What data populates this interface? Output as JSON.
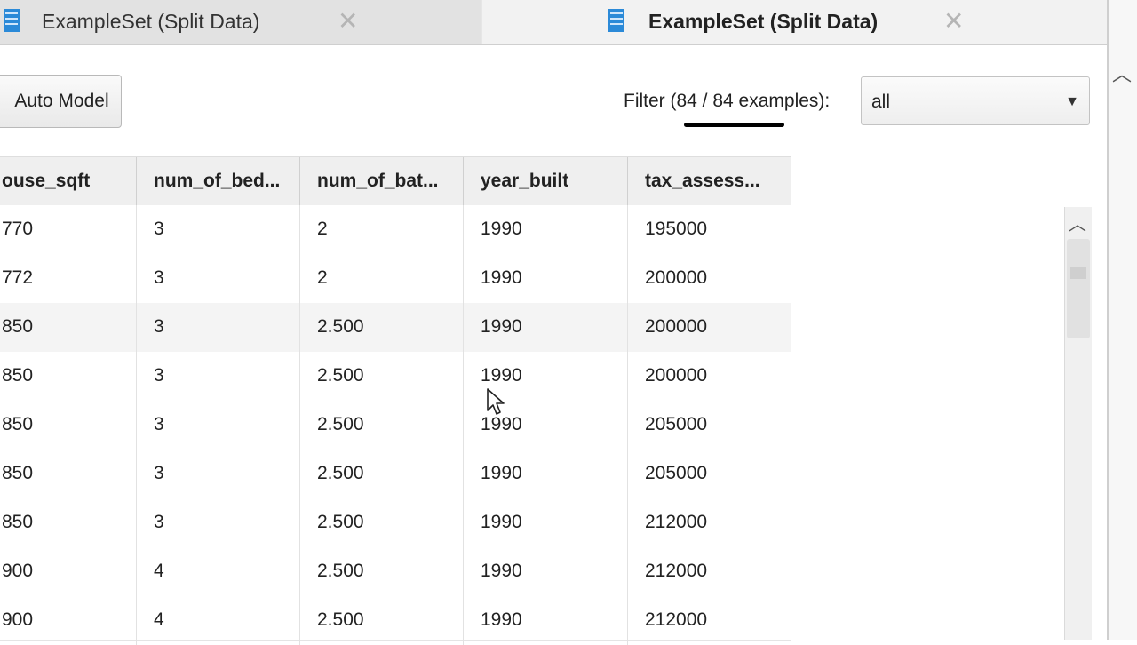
{
  "tabs": [
    {
      "title": "ExampleSet (Split Data)",
      "active": false
    },
    {
      "title": "ExampleSet (Split Data)",
      "active": true
    }
  ],
  "icons": {
    "tab": "data-table-icon",
    "close": "close-icon",
    "dropdown": "chevron-down-icon",
    "scroll_up": "chevron-up-icon",
    "cursor": "mouse-pointer-icon"
  },
  "colors": {
    "tab_icon": "#2b8ad8",
    "underline": "#000000"
  },
  "toolbar": {
    "auto_model_label": "Auto Model",
    "filter_label": "Filter (84 / 84 examples):",
    "filter_value": "all"
  },
  "table": {
    "columns": [
      "ouse_sqft",
      "num_of_bed...",
      "num_of_bat...",
      "year_built",
      "tax_assess..."
    ],
    "rows": [
      [
        "770",
        "3",
        "2",
        "1990",
        "195000"
      ],
      [
        "772",
        "3",
        "2",
        "1990",
        "200000"
      ],
      [
        "850",
        "3",
        "2.500",
        "1990",
        "200000"
      ],
      [
        "850",
        "3",
        "2.500",
        "1990",
        "200000"
      ],
      [
        "850",
        "3",
        "2.500",
        "1990",
        "205000"
      ],
      [
        "850",
        "3",
        "2.500",
        "1990",
        "205000"
      ],
      [
        "850",
        "3",
        "2.500",
        "1990",
        "212000"
      ],
      [
        "900",
        "4",
        "2.500",
        "1990",
        "212000"
      ],
      [
        "900",
        "4",
        "2.500",
        "1990",
        "212000"
      ]
    ]
  }
}
